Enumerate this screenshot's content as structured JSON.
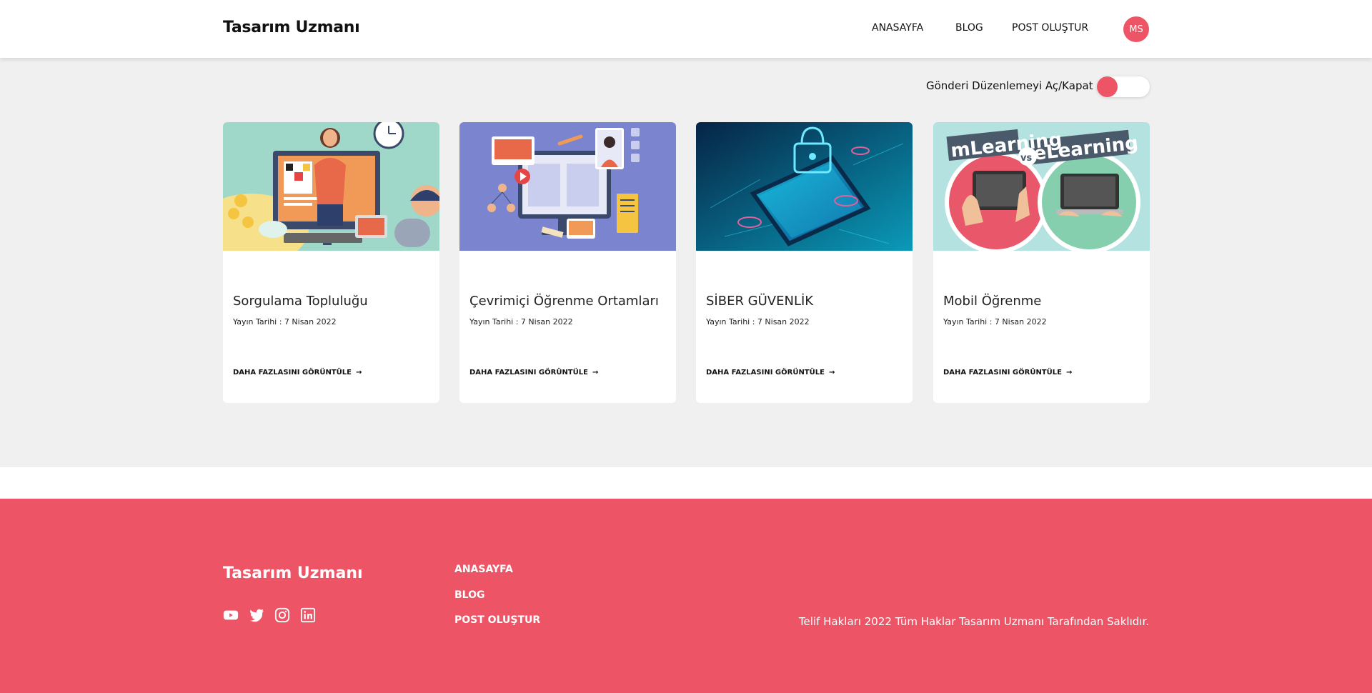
{
  "header": {
    "brand": "Tasarım Uzmanı",
    "nav": [
      "ANASAYFA",
      "BLOG",
      "POST OLUŞTUR"
    ],
    "avatar": "MS"
  },
  "toggle": {
    "label": "Gönderi Düzenlemeyi Aç/Kapat",
    "on": false,
    "accent": "#ed5566"
  },
  "cards": [
    {
      "title": "Sorgulama Topluluğu",
      "date": "Yayın Tarihi : 7 Nisan 2022",
      "link": "DAHA FAZLASINI GÖRÜNTÜLE"
    },
    {
      "title": "Çevrimiçi Öğrenme Ortamları",
      "date": "Yayın Tarihi : 7 Nisan 2022",
      "link": "DAHA FAZLASINI GÖRÜNTÜLE"
    },
    {
      "title": "SİBER GÜVENLİK",
      "date": "Yayın Tarihi : 7 Nisan 2022",
      "link": "DAHA FAZLASINI GÖRÜNTÜLE"
    },
    {
      "title": "Mobil Öğrenme",
      "date": "Yayın Tarihi : 7 Nisan 2022",
      "link": "DAHA FAZLASINI GÖRÜNTÜLE",
      "image_text": {
        "left": "mLearning",
        "vs": "vs",
        "right": "eLearning"
      }
    }
  ],
  "footer": {
    "brand": "Tasarım Uzmanı",
    "links": [
      "ANASAYFA",
      "BLOG",
      "POST OLUŞTUR"
    ],
    "socials": [
      "youtube-icon",
      "twitter-icon",
      "instagram-icon",
      "linkedin-icon"
    ],
    "copyright": "Telif Hakları 2022 Tüm Haklar Tasarım Uzmanı Tarafından Saklıdır."
  },
  "colors": {
    "accent": "#ed5566",
    "background": "#f0f0f0"
  }
}
